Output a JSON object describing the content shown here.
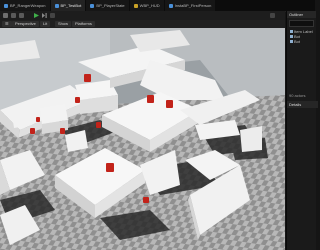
{
  "tabs": [
    {
      "label": "BP_RangerWeapon",
      "color": "#4a90d9"
    },
    {
      "label": "BP_TestBot",
      "color": "#4a90d9"
    },
    {
      "label": "BP_PlayerState",
      "color": "#4a90d9"
    },
    {
      "label": "WBP_HUD",
      "color": "#c9a227"
    },
    {
      "label": "InstaBP_FirstPerson",
      "color": "#4a90d9"
    }
  ],
  "viewport": {
    "perspective_label": "Perspective",
    "lit_label": "Lit",
    "show_label": "Show",
    "platforms_label": "Platforms"
  },
  "toolbar": {
    "play_color": "#3fae49",
    "save_color": "#6e6e6e"
  },
  "outliner": {
    "title": "Outliner",
    "items": [
      "Item Label",
      "Bot",
      "Bot"
    ],
    "count": "90 actors",
    "details_title": "Details"
  },
  "scene": {
    "floor_color_light": "#b8b8b8",
    "floor_color_dark": "#8f8f8f",
    "block_color": "#f2f2f2",
    "bot_color": "#c2231a",
    "wall_color": "#bfc3c6"
  }
}
